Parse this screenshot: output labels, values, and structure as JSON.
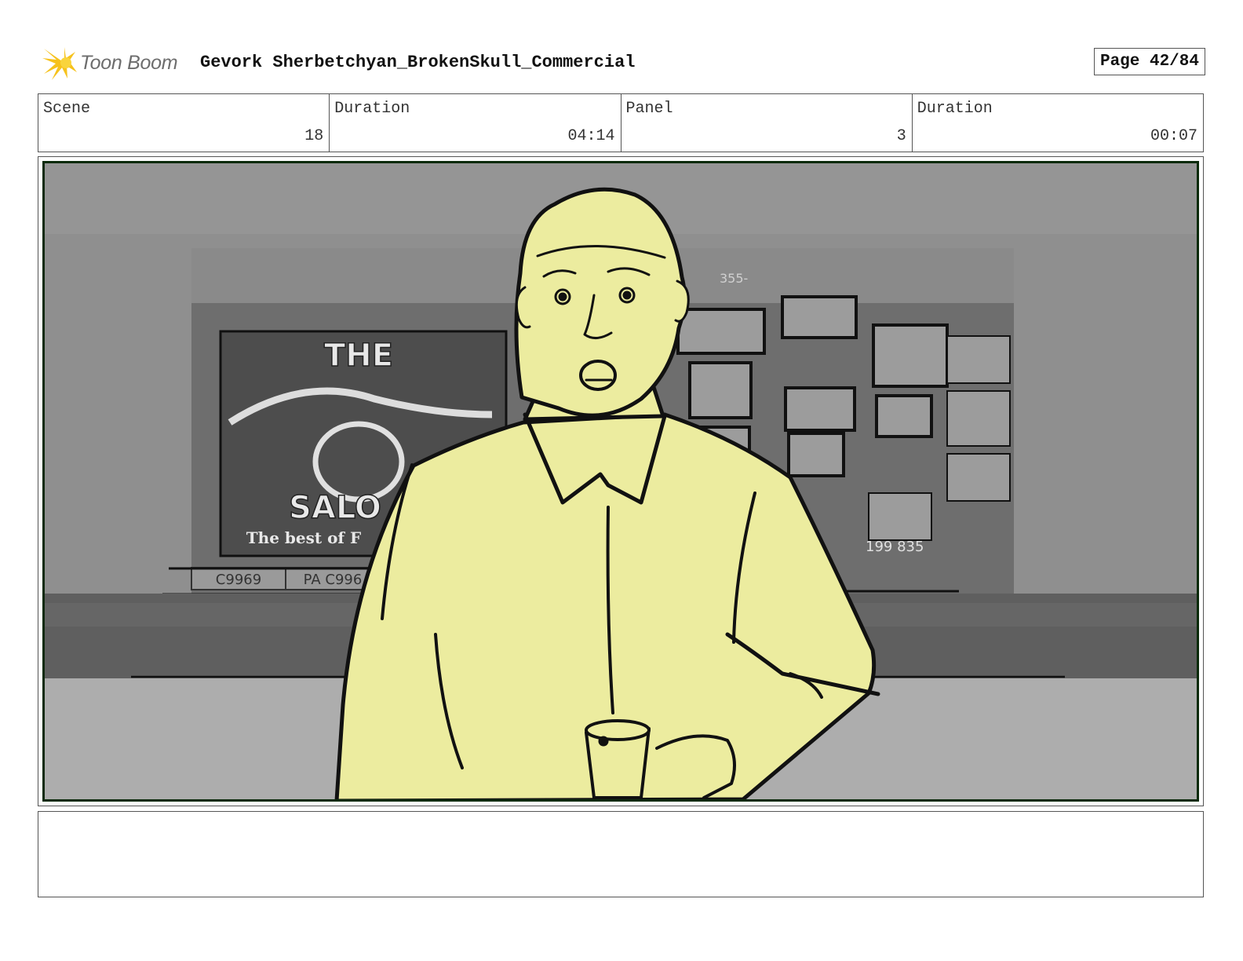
{
  "header": {
    "logo_text": "Toon Boom",
    "project_title": "Gevork Sherbetchyan_BrokenSkull_Commercial",
    "page_label": "Page 42/84"
  },
  "info": {
    "scene_label": "Scene",
    "scene_value": "18",
    "scene_duration_label": "Duration",
    "scene_duration_value": "04:14",
    "panel_label": "Panel",
    "panel_value": "3",
    "panel_duration_label": "Duration",
    "panel_duration_value": "00:07"
  },
  "panel": {
    "sign_text_top": "THE",
    "sign_text_bottom": "SALO",
    "sign_tagline": "The best of F",
    "plate_left": "C9969",
    "plate_right": "PA C996",
    "frame_number_top": "355-",
    "frame_number_bottom": "199 835",
    "colors": {
      "character_fill": "#ecec9f",
      "line": "#111111",
      "wall": "#8f8f8f",
      "floor": "#adadad",
      "counter": "#5f5f5f",
      "frame_border": "#0b2a0b"
    }
  },
  "notes": {
    "text": ""
  }
}
